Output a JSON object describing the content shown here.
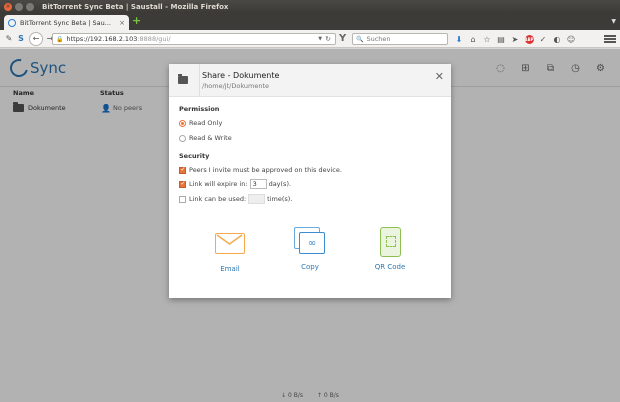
{
  "window": {
    "title": "BitTorrent Sync Beta | Saustall - Mozilla Firefox"
  },
  "browser": {
    "tab_label": "BitTorrent Sync Beta | Sau...",
    "url_host": "https://192.168.2.103",
    "url_rest": ":8888/gui/",
    "search_placeholder": "Suchen"
  },
  "app": {
    "logo_text": "Sync",
    "columns": {
      "name": "Name",
      "status": "Status"
    },
    "folders": [
      {
        "name": "Dokumente",
        "status": "No peers"
      }
    ],
    "footer": {
      "down": "↓ 0 B/s",
      "up": "↑ 0 B/s"
    }
  },
  "modal": {
    "title": "Share - Dokumente",
    "path": "/home/jt/Dokumente",
    "permission": {
      "label": "Permission",
      "read_only": "Read Only",
      "read_write": "Read & Write",
      "selected": "read_only"
    },
    "security": {
      "label": "Security",
      "approve_label": "Peers I invite must be approved on this device.",
      "approve_checked": true,
      "expire_prefix": "Link will expire in:",
      "expire_value": "3",
      "expire_suffix": "day(s).",
      "expire_checked": true,
      "used_prefix": "Link can be used:",
      "used_value": "",
      "used_suffix": "time(s).",
      "used_checked": false
    },
    "share_options": [
      {
        "label": "Email",
        "icon": "envelope-icon",
        "color": "#f5a94e"
      },
      {
        "label": "Copy",
        "icon": "copy-link-icon",
        "color": "#3d8bd0"
      },
      {
        "label": "QR Code",
        "icon": "qr-code-icon",
        "color": "#8cc152"
      }
    ]
  },
  "colors": {
    "accent": "#e8743b",
    "link": "#2d78b4"
  }
}
